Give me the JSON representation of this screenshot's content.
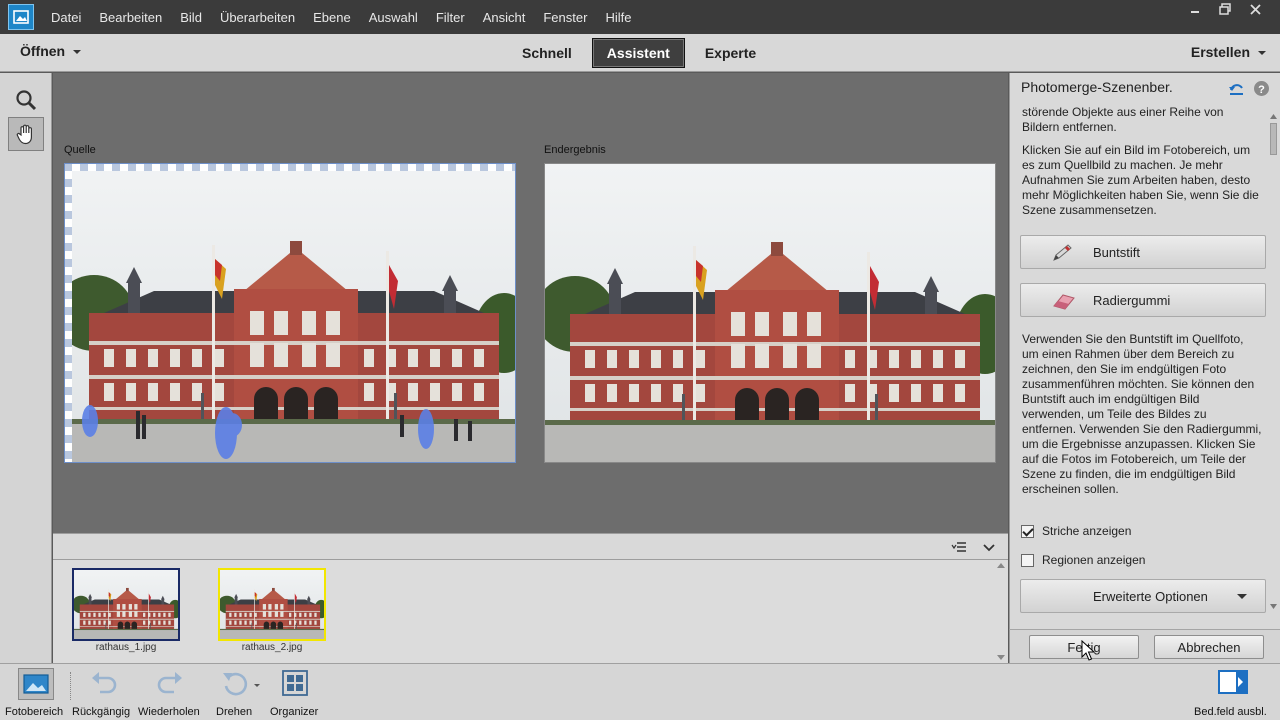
{
  "menubar": {
    "items": [
      "Datei",
      "Bearbeiten",
      "Bild",
      "Überarbeiten",
      "Ebene",
      "Auswahl",
      "Filter",
      "Ansicht",
      "Fenster",
      "Hilfe"
    ],
    "window_controls": [
      "minimize-icon",
      "restore-icon",
      "close-icon"
    ]
  },
  "modebar": {
    "open_label": "Öffnen",
    "tabs": [
      {
        "label": "Schnell",
        "active": false
      },
      {
        "label": "Assistent",
        "active": true
      },
      {
        "label": "Experte",
        "active": false
      }
    ],
    "create_label": "Erstellen"
  },
  "tools": [
    "zoom-icon",
    "hand-icon"
  ],
  "canvas": {
    "source_label": "Quelle",
    "result_label": "Endergebnis"
  },
  "filmstrip": {
    "thumbnails": [
      {
        "label": "rathaus_1.jpg",
        "state": "source"
      },
      {
        "label": "rathaus_2.jpg",
        "state": "selected"
      }
    ]
  },
  "panel": {
    "title": "Photomerge-Szenenber.",
    "intro_text": "störende Objekte aus einer Reihe von Bildern entfernen.",
    "instructions_1": "Klicken Sie auf ein Bild im Fotobereich, um es zum Quellbild zu machen. Je mehr Aufnahmen Sie zum Arbeiten haben, desto mehr Möglichkeiten haben Sie, wenn Sie die Szene zusammensetzen.",
    "pencil_label": "Buntstift",
    "eraser_label": "Radiergummi",
    "instructions_2": "Verwenden Sie den Buntstift im Quellfoto, um einen Rahmen über dem Bereich zu zeichnen, den Sie im endgültigen Foto zusammenführen möchten. Sie können den Buntstift auch im endgültigen Bild verwenden, um Teile des Bildes zu entfernen. Verwenden Sie den Radiergummi, um die Ergebnisse anzupassen. Klicken Sie auf die Fotos im Fotobereich, um Teile der Szene zu finden, die im endgültigen Bild erscheinen sollen.",
    "show_strokes": {
      "label": "Striche anzeigen",
      "checked": true
    },
    "show_regions": {
      "label": "Regionen anzeigen",
      "checked": false
    },
    "advanced_label": "Erweiterte Optionen",
    "done_label": "Fertig",
    "cancel_label": "Abbrechen"
  },
  "taskbar": {
    "photobin_label": "Fotobereich",
    "undo_label": "Rückgängig",
    "redo_label": "Wiederholen",
    "rotate_label": "Drehen",
    "organizer_label": "Organizer",
    "hide_panel_label": "Bed.feld ausbl."
  },
  "colors": {
    "menubar_bg": "#3b3b3b",
    "active_tab_bg": "#3f3f3f",
    "stroke_blue": "#5b7fe6",
    "selected_thumb_border": "#f2e600",
    "source_thumb_border": "#1a2a66"
  }
}
